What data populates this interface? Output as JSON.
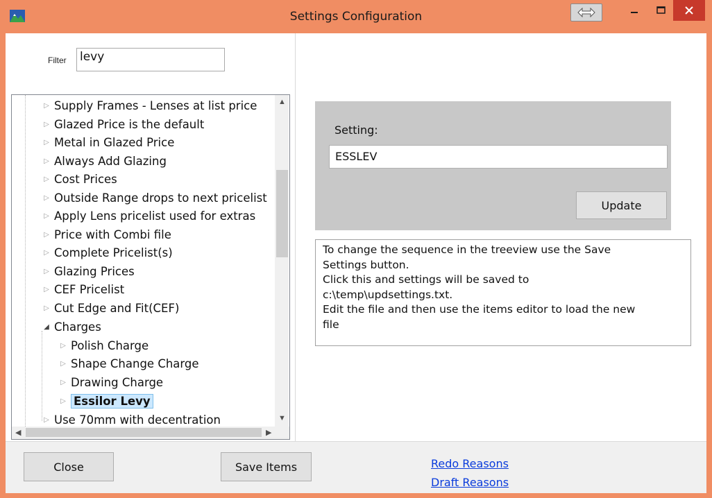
{
  "window": {
    "title": "Settings Configuration",
    "accent_color": "#f08d63",
    "close_color": "#c7392b"
  },
  "filter": {
    "label": "Filter",
    "value": "levy"
  },
  "tree": {
    "items": [
      {
        "label": "Supply Frames - Lenses at list price",
        "expanded": false,
        "selected": false
      },
      {
        "label": "Glazed Price is the default",
        "expanded": false,
        "selected": false
      },
      {
        "label": "Metal in Glazed Price",
        "expanded": false,
        "selected": false
      },
      {
        "label": "Always Add Glazing",
        "expanded": false,
        "selected": false
      },
      {
        "label": "Cost Prices",
        "expanded": false,
        "selected": false
      },
      {
        "label": "Outside Range drops to next pricelist",
        "expanded": false,
        "selected": false
      },
      {
        "label": "Apply Lens pricelist used for extras",
        "expanded": false,
        "selected": false
      },
      {
        "label": "Price with Combi file",
        "expanded": false,
        "selected": false
      },
      {
        "label": "Complete Pricelist(s)",
        "expanded": false,
        "selected": false
      },
      {
        "label": "Glazing Prices",
        "expanded": false,
        "selected": false
      },
      {
        "label": "CEF Pricelist",
        "expanded": false,
        "selected": false
      },
      {
        "label": "Cut Edge and Fit(CEF)",
        "expanded": false,
        "selected": false
      },
      {
        "label": "Charges",
        "expanded": true,
        "selected": false
      },
      {
        "label": "Polish Charge",
        "expanded": false,
        "selected": false
      },
      {
        "label": "Shape Change Charge",
        "expanded": false,
        "selected": false
      },
      {
        "label": "Drawing Charge",
        "expanded": false,
        "selected": false
      },
      {
        "label": "Essilor Levy",
        "expanded": false,
        "selected": true
      },
      {
        "label": "Use 70mm with decentration",
        "expanded": false,
        "selected": false
      }
    ]
  },
  "setting": {
    "label": "Setting:",
    "value": "ESSLEV",
    "update_label": "Update"
  },
  "info": {
    "lines": [
      "To change the sequence in the treeview use the Save",
      "Settings button.",
      "Click this and settings will be saved to",
      "c:\\temp\\updsettings.txt.",
      "Edit the file and then use the items editor to load the new",
      "file"
    ]
  },
  "footer": {
    "close_label": "Close",
    "save_items_label": "Save Items",
    "redo_reasons_label": "Redo Reasons",
    "draft_reasons_label": "Draft Reasons"
  }
}
